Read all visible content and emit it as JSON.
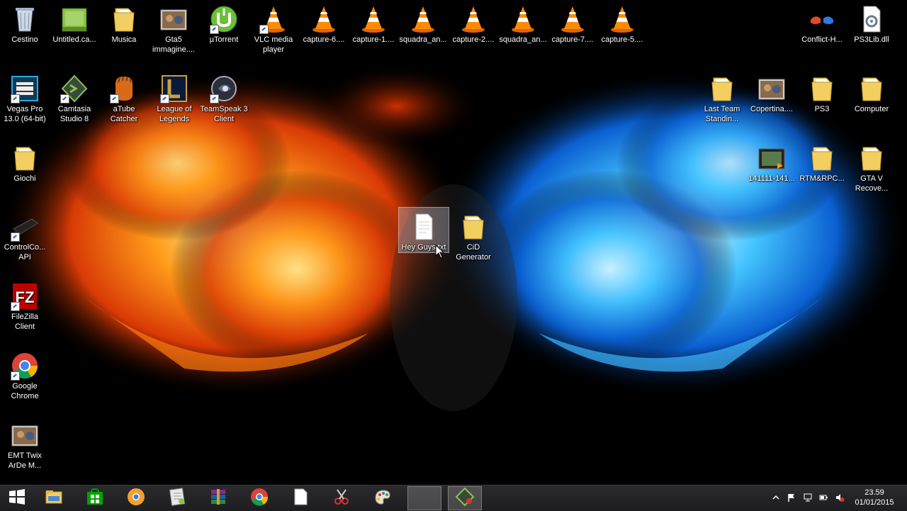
{
  "desktop": {
    "icons": [
      {
        "label": "Cestino",
        "icon": "recycle-bin-icon"
      },
      {
        "label": "Untitled.ca...",
        "icon": "camtasia-project-icon"
      },
      {
        "label": "Musica",
        "icon": "folder-icon"
      },
      {
        "label": "Gta5\nimmagine....",
        "icon": "image-thumbnail-icon"
      },
      {
        "label": "µTorrent",
        "icon": "utorrent-icon"
      },
      {
        "label": "VLC media\nplayer",
        "icon": "vlc-icon"
      },
      {
        "label": "capture-6....",
        "icon": "vlc-icon"
      },
      {
        "label": "capture-1....",
        "icon": "vlc-icon"
      },
      {
        "label": "squadra_an...",
        "icon": "vlc-icon"
      },
      {
        "label": "capture-2....",
        "icon": "vlc-icon"
      },
      {
        "label": "squadra_an...",
        "icon": "vlc-icon"
      },
      {
        "label": "capture-7....",
        "icon": "vlc-icon"
      },
      {
        "label": "capture-5....",
        "icon": "vlc-icon"
      },
      {
        "label": "Conflict-H...",
        "icon": "conflict-app-icon"
      },
      {
        "label": "PS3Lib.dll",
        "icon": "dll-file-icon"
      },
      {
        "label": "Vegas Pro\n13.0 (64-bit)",
        "icon": "vegas-pro-icon"
      },
      {
        "label": "Camtasia\nStudio 8",
        "icon": "camtasia-icon"
      },
      {
        "label": "aTube\nCatcher",
        "icon": "atube-catcher-icon"
      },
      {
        "label": "League of\nLegends",
        "icon": "league-of-legends-icon"
      },
      {
        "label": "TeamSpeak 3\nClient",
        "icon": "teamspeak-icon"
      },
      {
        "label": "Last Team\nStandin...",
        "icon": "folder-icon"
      },
      {
        "label": "Copertina....",
        "icon": "image-thumbnail-icon"
      },
      {
        "label": "PS3",
        "icon": "folder-icon"
      },
      {
        "label": "Computer",
        "icon": "folder-icon"
      },
      {
        "label": "Giochi",
        "icon": "folder-icon"
      },
      {
        "label": "141111-141...",
        "icon": "video-file-icon"
      },
      {
        "label": "RTM&RPC...",
        "icon": "folder-icon"
      },
      {
        "label": "GTA V\nRecove...",
        "icon": "folder-icon"
      },
      {
        "label": "Hey Guys.txt",
        "icon": "text-document-icon"
      },
      {
        "label": "CiD\nGenerator",
        "icon": "folder-icon"
      },
      {
        "label": "ControlCo...\nAPI",
        "icon": "ps3-console-icon"
      },
      {
        "label": "FileZilla\nClient",
        "icon": "filezilla-icon"
      },
      {
        "label": "Google\nChrome",
        "icon": "chrome-icon"
      },
      {
        "label": "EMT Twix\nArDe M...",
        "icon": "image-thumbnail-icon"
      }
    ]
  },
  "taskbar": {
    "items": [
      {
        "icon": "windows-start-icon"
      },
      {
        "icon": "file-explorer-icon"
      },
      {
        "icon": "windows-store-icon"
      },
      {
        "icon": "chrome-canary-icon"
      },
      {
        "icon": "notepad-plus-icon"
      },
      {
        "icon": "winrar-icon"
      },
      {
        "icon": "chrome-icon"
      },
      {
        "icon": "blank-document-icon"
      },
      {
        "icon": "snipping-tool-icon"
      },
      {
        "icon": "paint-icon"
      },
      {
        "icon": "camtasia-icon"
      },
      {
        "icon": "camtasia-recorder-icon"
      }
    ],
    "tray": [
      "show-hidden-icons-icon",
      "action-center-flag-icon",
      "network-icon",
      "power-icon",
      "volume-muted-icon"
    ],
    "clock_time": "23.59",
    "clock_date": "01/01/2015"
  },
  "colors": {
    "fire": "#ff6a00",
    "ice": "#29a8ff",
    "taskbar": "#232326"
  }
}
